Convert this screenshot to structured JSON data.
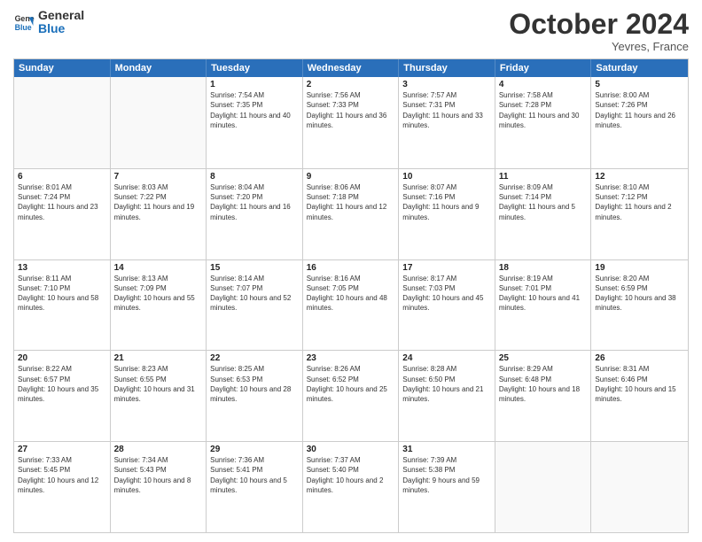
{
  "header": {
    "logo_line1": "General",
    "logo_line2": "Blue",
    "month": "October 2024",
    "location": "Yevres, France"
  },
  "days_of_week": [
    "Sunday",
    "Monday",
    "Tuesday",
    "Wednesday",
    "Thursday",
    "Friday",
    "Saturday"
  ],
  "rows": [
    [
      {
        "day": "",
        "sunrise": "",
        "sunset": "",
        "daylight": "",
        "empty": true
      },
      {
        "day": "",
        "sunrise": "",
        "sunset": "",
        "daylight": "",
        "empty": true
      },
      {
        "day": "1",
        "sunrise": "Sunrise: 7:54 AM",
        "sunset": "Sunset: 7:35 PM",
        "daylight": "Daylight: 11 hours and 40 minutes.",
        "empty": false
      },
      {
        "day": "2",
        "sunrise": "Sunrise: 7:56 AM",
        "sunset": "Sunset: 7:33 PM",
        "daylight": "Daylight: 11 hours and 36 minutes.",
        "empty": false
      },
      {
        "day": "3",
        "sunrise": "Sunrise: 7:57 AM",
        "sunset": "Sunset: 7:31 PM",
        "daylight": "Daylight: 11 hours and 33 minutes.",
        "empty": false
      },
      {
        "day": "4",
        "sunrise": "Sunrise: 7:58 AM",
        "sunset": "Sunset: 7:28 PM",
        "daylight": "Daylight: 11 hours and 30 minutes.",
        "empty": false
      },
      {
        "day": "5",
        "sunrise": "Sunrise: 8:00 AM",
        "sunset": "Sunset: 7:26 PM",
        "daylight": "Daylight: 11 hours and 26 minutes.",
        "empty": false
      }
    ],
    [
      {
        "day": "6",
        "sunrise": "Sunrise: 8:01 AM",
        "sunset": "Sunset: 7:24 PM",
        "daylight": "Daylight: 11 hours and 23 minutes.",
        "empty": false
      },
      {
        "day": "7",
        "sunrise": "Sunrise: 8:03 AM",
        "sunset": "Sunset: 7:22 PM",
        "daylight": "Daylight: 11 hours and 19 minutes.",
        "empty": false
      },
      {
        "day": "8",
        "sunrise": "Sunrise: 8:04 AM",
        "sunset": "Sunset: 7:20 PM",
        "daylight": "Daylight: 11 hours and 16 minutes.",
        "empty": false
      },
      {
        "day": "9",
        "sunrise": "Sunrise: 8:06 AM",
        "sunset": "Sunset: 7:18 PM",
        "daylight": "Daylight: 11 hours and 12 minutes.",
        "empty": false
      },
      {
        "day": "10",
        "sunrise": "Sunrise: 8:07 AM",
        "sunset": "Sunset: 7:16 PM",
        "daylight": "Daylight: 11 hours and 9 minutes.",
        "empty": false
      },
      {
        "day": "11",
        "sunrise": "Sunrise: 8:09 AM",
        "sunset": "Sunset: 7:14 PM",
        "daylight": "Daylight: 11 hours and 5 minutes.",
        "empty": false
      },
      {
        "day": "12",
        "sunrise": "Sunrise: 8:10 AM",
        "sunset": "Sunset: 7:12 PM",
        "daylight": "Daylight: 11 hours and 2 minutes.",
        "empty": false
      }
    ],
    [
      {
        "day": "13",
        "sunrise": "Sunrise: 8:11 AM",
        "sunset": "Sunset: 7:10 PM",
        "daylight": "Daylight: 10 hours and 58 minutes.",
        "empty": false
      },
      {
        "day": "14",
        "sunrise": "Sunrise: 8:13 AM",
        "sunset": "Sunset: 7:09 PM",
        "daylight": "Daylight: 10 hours and 55 minutes.",
        "empty": false
      },
      {
        "day": "15",
        "sunrise": "Sunrise: 8:14 AM",
        "sunset": "Sunset: 7:07 PM",
        "daylight": "Daylight: 10 hours and 52 minutes.",
        "empty": false
      },
      {
        "day": "16",
        "sunrise": "Sunrise: 8:16 AM",
        "sunset": "Sunset: 7:05 PM",
        "daylight": "Daylight: 10 hours and 48 minutes.",
        "empty": false
      },
      {
        "day": "17",
        "sunrise": "Sunrise: 8:17 AM",
        "sunset": "Sunset: 7:03 PM",
        "daylight": "Daylight: 10 hours and 45 minutes.",
        "empty": false
      },
      {
        "day": "18",
        "sunrise": "Sunrise: 8:19 AM",
        "sunset": "Sunset: 7:01 PM",
        "daylight": "Daylight: 10 hours and 41 minutes.",
        "empty": false
      },
      {
        "day": "19",
        "sunrise": "Sunrise: 8:20 AM",
        "sunset": "Sunset: 6:59 PM",
        "daylight": "Daylight: 10 hours and 38 minutes.",
        "empty": false
      }
    ],
    [
      {
        "day": "20",
        "sunrise": "Sunrise: 8:22 AM",
        "sunset": "Sunset: 6:57 PM",
        "daylight": "Daylight: 10 hours and 35 minutes.",
        "empty": false
      },
      {
        "day": "21",
        "sunrise": "Sunrise: 8:23 AM",
        "sunset": "Sunset: 6:55 PM",
        "daylight": "Daylight: 10 hours and 31 minutes.",
        "empty": false
      },
      {
        "day": "22",
        "sunrise": "Sunrise: 8:25 AM",
        "sunset": "Sunset: 6:53 PM",
        "daylight": "Daylight: 10 hours and 28 minutes.",
        "empty": false
      },
      {
        "day": "23",
        "sunrise": "Sunrise: 8:26 AM",
        "sunset": "Sunset: 6:52 PM",
        "daylight": "Daylight: 10 hours and 25 minutes.",
        "empty": false
      },
      {
        "day": "24",
        "sunrise": "Sunrise: 8:28 AM",
        "sunset": "Sunset: 6:50 PM",
        "daylight": "Daylight: 10 hours and 21 minutes.",
        "empty": false
      },
      {
        "day": "25",
        "sunrise": "Sunrise: 8:29 AM",
        "sunset": "Sunset: 6:48 PM",
        "daylight": "Daylight: 10 hours and 18 minutes.",
        "empty": false
      },
      {
        "day": "26",
        "sunrise": "Sunrise: 8:31 AM",
        "sunset": "Sunset: 6:46 PM",
        "daylight": "Daylight: 10 hours and 15 minutes.",
        "empty": false
      }
    ],
    [
      {
        "day": "27",
        "sunrise": "Sunrise: 7:33 AM",
        "sunset": "Sunset: 5:45 PM",
        "daylight": "Daylight: 10 hours and 12 minutes.",
        "empty": false
      },
      {
        "day": "28",
        "sunrise": "Sunrise: 7:34 AM",
        "sunset": "Sunset: 5:43 PM",
        "daylight": "Daylight: 10 hours and 8 minutes.",
        "empty": false
      },
      {
        "day": "29",
        "sunrise": "Sunrise: 7:36 AM",
        "sunset": "Sunset: 5:41 PM",
        "daylight": "Daylight: 10 hours and 5 minutes.",
        "empty": false
      },
      {
        "day": "30",
        "sunrise": "Sunrise: 7:37 AM",
        "sunset": "Sunset: 5:40 PM",
        "daylight": "Daylight: 10 hours and 2 minutes.",
        "empty": false
      },
      {
        "day": "31",
        "sunrise": "Sunrise: 7:39 AM",
        "sunset": "Sunset: 5:38 PM",
        "daylight": "Daylight: 9 hours and 59 minutes.",
        "empty": false
      },
      {
        "day": "",
        "sunrise": "",
        "sunset": "",
        "daylight": "",
        "empty": true
      },
      {
        "day": "",
        "sunrise": "",
        "sunset": "",
        "daylight": "",
        "empty": true
      }
    ]
  ]
}
